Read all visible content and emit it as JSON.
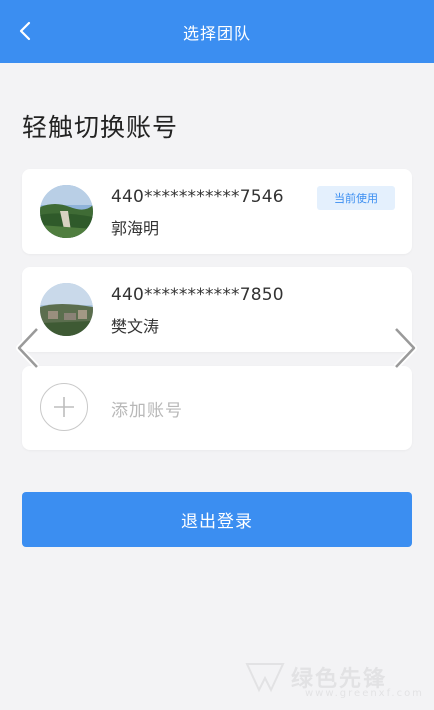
{
  "header": {
    "title": "选择团队",
    "back_icon": "chevron-left-icon"
  },
  "section_title": "轻触切换账号",
  "accounts": [
    {
      "number": "440***********7546",
      "name": "郭海明",
      "badge": "当前使用",
      "current": true
    },
    {
      "number": "440***********7850",
      "name": "樊文涛",
      "current": false
    }
  ],
  "add_account": {
    "label": "添加账号",
    "icon": "plus-icon"
  },
  "logout_label": "退出登录",
  "watermark": {
    "text": "绿色先锋",
    "url": "www.greenxf.com"
  },
  "colors": {
    "primary": "#3b8ef1",
    "badge_bg": "#e4f0fd",
    "background": "#f3f3f5"
  }
}
